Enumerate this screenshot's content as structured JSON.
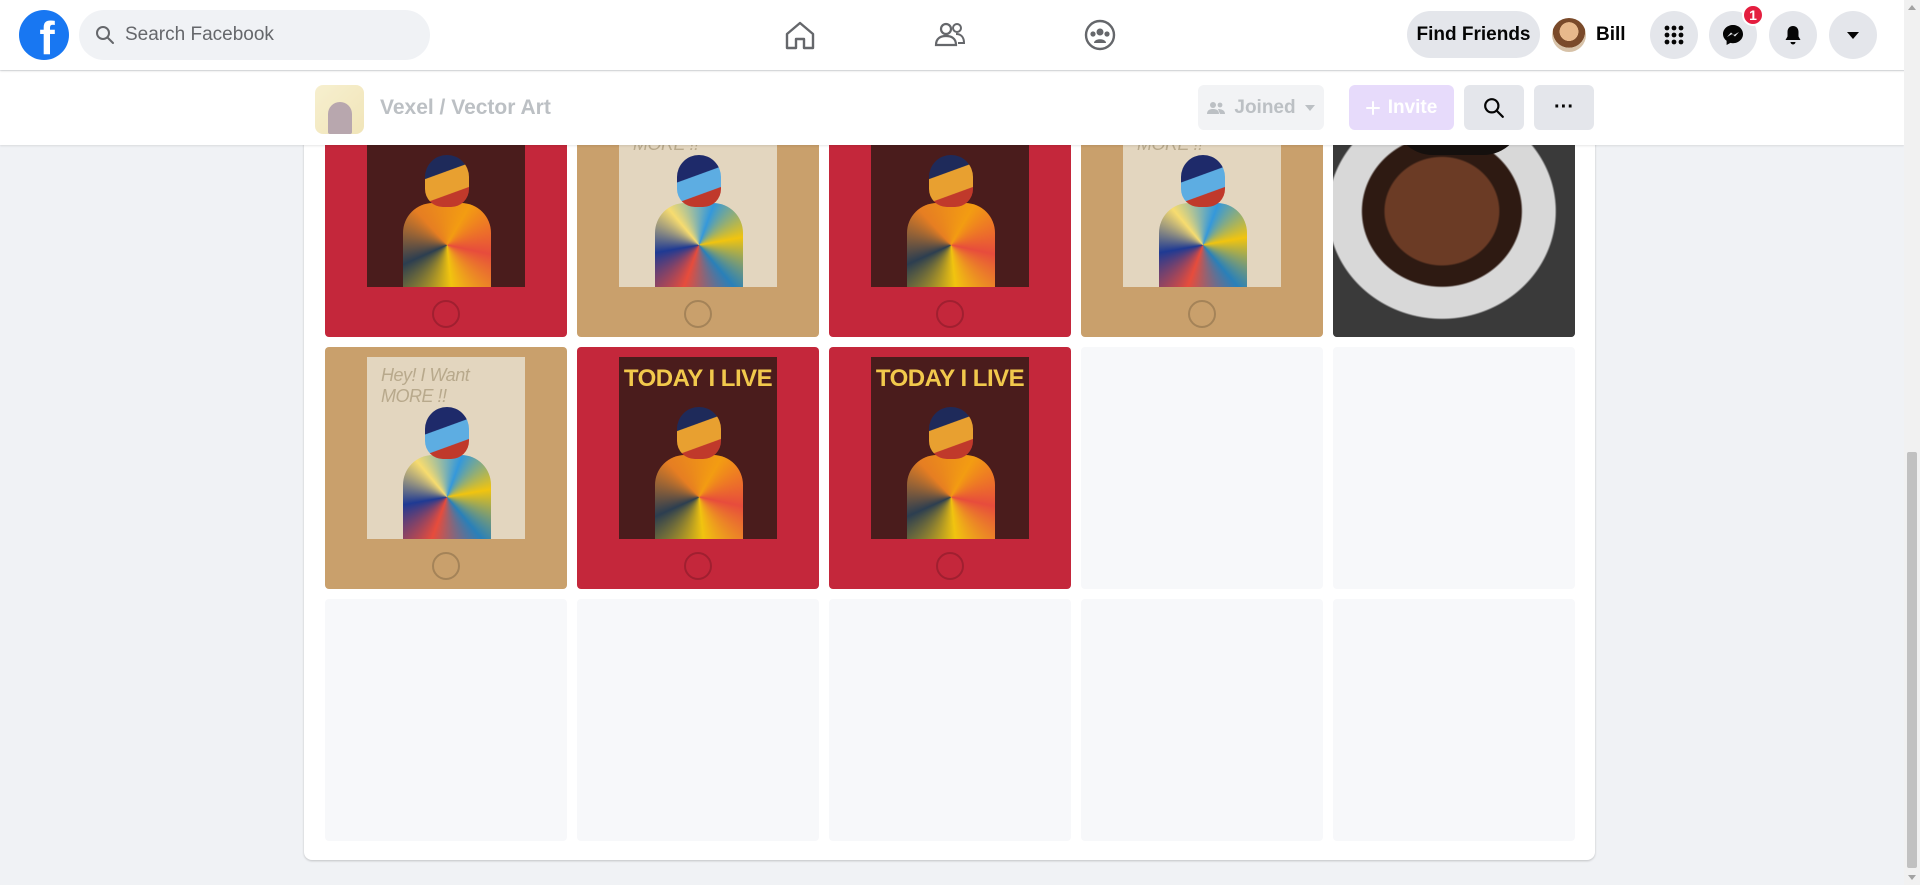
{
  "topbar": {
    "logo_letter": "f",
    "search_placeholder": "Search Facebook",
    "nav": [
      {
        "name": "home-icon"
      },
      {
        "name": "friends-icon"
      },
      {
        "name": "groups-icon"
      }
    ],
    "find_friends_label": "Find Friends",
    "profile_name": "Bill",
    "messenger_badge": "1"
  },
  "group": {
    "name": "Vexel / Vector Art",
    "joined_label": "Joined",
    "invite_label": "Invite",
    "more_label": "···"
  },
  "photos": {
    "row1": [
      "red-poster",
      "tan-poster",
      "red-poster",
      "tan-poster",
      "portrait-photo"
    ],
    "row2": [
      "tan-poster",
      "red-poster",
      "red-poster",
      "placeholder",
      "placeholder"
    ],
    "row3": [
      "placeholder",
      "placeholder",
      "placeholder",
      "placeholder",
      "placeholder"
    ],
    "poster_red_text": "TODAY I LIVE",
    "poster_tan_text": "Hey! I Want MORE !!"
  },
  "colors": {
    "brand": "#1877f2",
    "badge": "#e41e3f",
    "poster_red": "#c4273b",
    "poster_tan": "#c9a06c"
  }
}
